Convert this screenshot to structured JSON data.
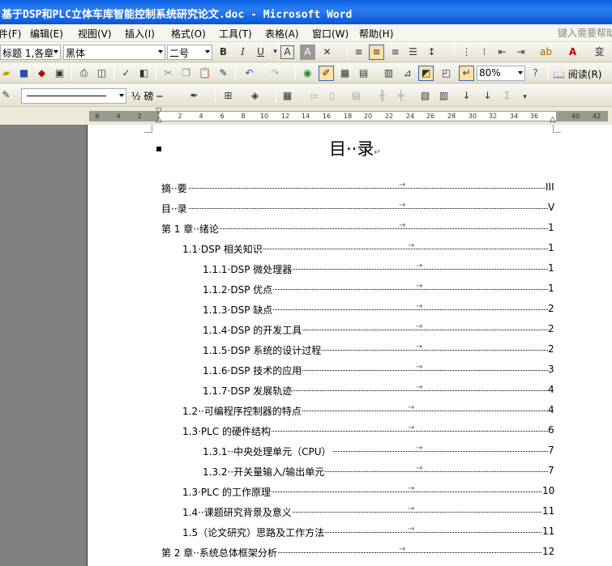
{
  "window": {
    "title": "基于DSP和PLC立体车库智能控制系统研究论文.doc - Microsoft Word"
  },
  "menu": {
    "items": [
      "件(F)",
      "编辑(E)",
      "视图(V)",
      "插入(I)",
      "格式(O)",
      "工具(T)",
      "表格(A)",
      "窗口(W)",
      "帮助(H)"
    ],
    "help_box": "键入需要帮助"
  },
  "format_toolbar": {
    "style": "标题 1,各章",
    "font": "黑体",
    "size": "二号",
    "bold": "B",
    "italic": "I",
    "underline": "U"
  },
  "standard_toolbar": {
    "zoom": "80%",
    "read_label": "阅读(R)"
  },
  "drawing_toolbar": {
    "line_weight": "½ 磅"
  },
  "ruler": {
    "numbers": [
      "6",
      "4",
      "2",
      "2",
      "4",
      "6",
      "8",
      "10",
      "12",
      "14",
      "16",
      "18",
      "20",
      "22",
      "24",
      "26",
      "28",
      "30",
      "32",
      "34",
      "36",
      "40",
      "42"
    ]
  },
  "document": {
    "title": "目··录",
    "toc": [
      {
        "label": "摘··要",
        "page": "III",
        "level": 0
      },
      {
        "label": "目··录",
        "page": "V",
        "level": 0
      },
      {
        "label": "第 1 章··绪论",
        "page": "1",
        "level": 0
      },
      {
        "label": "1.1·DSP 相关知识",
        "page": "1",
        "level": 1
      },
      {
        "label": "1.1.1·DSP 微处理器",
        "page": "1",
        "level": 2
      },
      {
        "label": "1.1.2·DSP 优点",
        "page": "1",
        "level": 2
      },
      {
        "label": "1.1.3·DSP 缺点",
        "page": "2",
        "level": 2
      },
      {
        "label": "1.1.4·DSP 的开发工具",
        "page": "2",
        "level": 2
      },
      {
        "label": "1.1.5·DSP 系统的设计过程",
        "page": "2",
        "level": 2
      },
      {
        "label": "1.1.6·DSP 技术的应用",
        "page": "3",
        "level": 2
      },
      {
        "label": "1.1.7·DSP 发展轨迹",
        "page": "4",
        "level": 2
      },
      {
        "label": "1.2··可编程序控制器的特点",
        "page": "4",
        "level": 1
      },
      {
        "label": "1.3·PLC 的硬件结构",
        "page": "6",
        "level": 1
      },
      {
        "label": "1.3.1··中央处理单元（CPU）",
        "page": "7",
        "level": 2
      },
      {
        "label": "1.3.2··开关量输入/输出单元",
        "page": "7",
        "level": 2
      },
      {
        "label": "1.3·PLC 的工作原理",
        "page": "10",
        "level": 1
      },
      {
        "label": "1.4··课题研究背景及意义",
        "page": "11",
        "level": 1
      },
      {
        "label": "1.5（论文研究）思路及工作方法",
        "page": "11",
        "level": 1
      },
      {
        "label": "第 2 章··系统总体框架分析",
        "page": "12",
        "level": 0
      }
    ]
  }
}
